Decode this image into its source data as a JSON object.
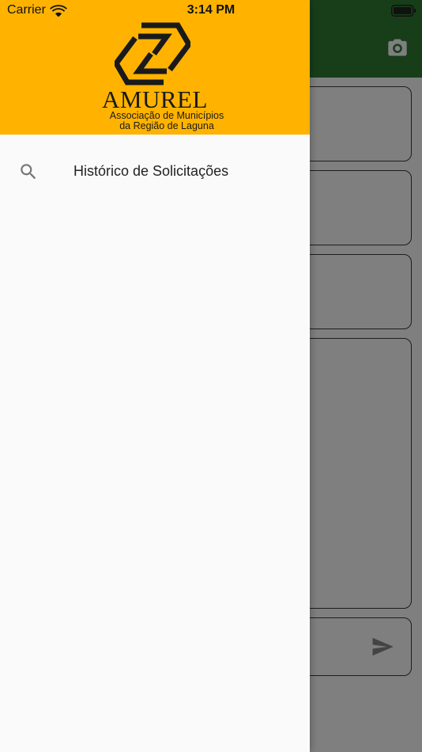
{
  "status_bar": {
    "carrier": "Carrier",
    "time": "3:14 PM"
  },
  "app": {
    "icons": {
      "camera": "camera-icon",
      "send": "send-icon"
    },
    "colors": {
      "app_bar": "#2e7d32",
      "scrim": "rgba(0,0,0,0.5)"
    }
  },
  "drawer": {
    "header": {
      "logo_title": "AMUREL",
      "logo_line1": "Associação de Municípios",
      "logo_line2": "da Região de Laguna",
      "color": "#ffb300"
    },
    "items": [
      {
        "icon": "search-icon",
        "label": "Histórico de Solicitações"
      }
    ]
  }
}
